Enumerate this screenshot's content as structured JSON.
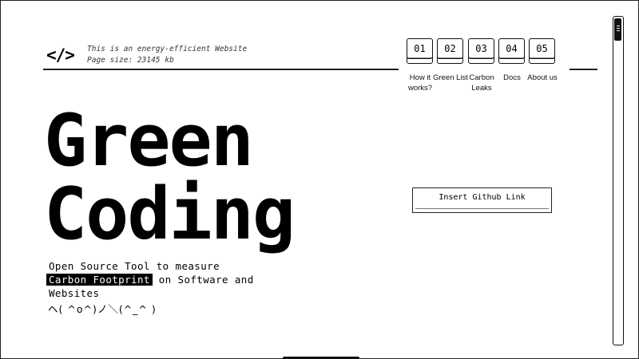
{
  "header": {
    "logo": "</>",
    "tagline_line1": "This is an energy-efficient Website",
    "tagline_line2": "Page size: 23145 kb"
  },
  "nav": {
    "items": [
      {
        "number": "01",
        "label": "How it works?"
      },
      {
        "number": "02",
        "label": "Green List"
      },
      {
        "number": "03",
        "label": "Carbon Leaks"
      },
      {
        "number": "04",
        "label": "Docs"
      },
      {
        "number": "05",
        "label": "About us"
      }
    ]
  },
  "hero": {
    "title_line1": "Green",
    "title_line2": "Coding",
    "desc_part1": "Open Source Tool to measure",
    "desc_highlight": "Carbon Footprint",
    "desc_part2": "on Software and Websites",
    "kaomoji": "ヘ( ^o^)ノ＼(^_^ )"
  },
  "github": {
    "button_label": "Insert Github Link"
  },
  "icons": {
    "logo_icon": "code-brackets-icon",
    "scroll_icon": "scrollbar-grip-icon"
  },
  "colors": {
    "background": "#ffffff",
    "foreground": "#000000"
  }
}
